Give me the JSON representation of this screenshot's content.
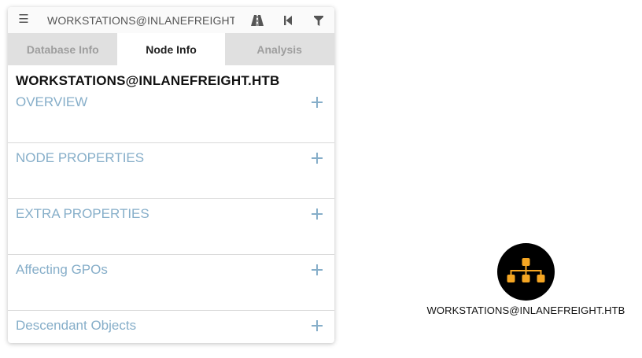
{
  "search": {
    "value": "WORKSTATIONS@INLANEFREIGHT.HTB"
  },
  "toolbar": {
    "menu_icon": "hamburger-menu-icon",
    "path_icon": "road-path-icon",
    "back_icon": "step-back-icon",
    "filter_icon": "filter-icon"
  },
  "tabs": [
    {
      "label": "Database Info",
      "active": false
    },
    {
      "label": "Node Info",
      "active": true
    },
    {
      "label": "Analysis",
      "active": false
    }
  ],
  "node_info": {
    "title": "WORKSTATIONS@INLANEFREIGHT.HTB",
    "sections": [
      {
        "label": "OVERVIEW"
      },
      {
        "label": "NODE PROPERTIES"
      },
      {
        "label": "EXTRA PROPERTIES"
      },
      {
        "label": "Affecting GPOs"
      },
      {
        "label": "Descendant Objects"
      }
    ]
  },
  "graph": {
    "node": {
      "label": "WORKSTATIONS@INLANEFREIGHT.HTB",
      "icon": "org-chart-icon",
      "icon_color": "#f5a623",
      "circle_color": "#000000"
    }
  }
}
